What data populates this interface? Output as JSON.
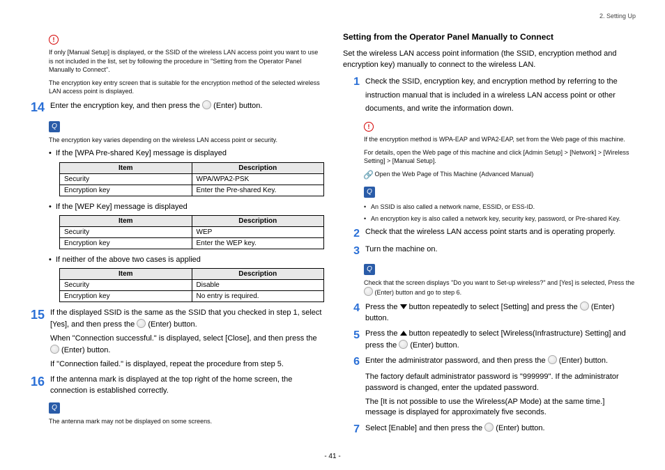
{
  "header": {
    "chapter": "2. Setting Up"
  },
  "page_number": "- 41 -",
  "left": {
    "warn1": {
      "lines": [
        "If only [Manual Setup] is displayed, or the SSID of the wireless LAN access point you want to use is not included in the list, set by following the procedure in \"Setting from the Operator Panel Manually to Connect\".",
        "The encryption key entry screen that is suitable for the encryption method of the selected wireless LAN access point is displayed."
      ]
    },
    "step14": {
      "num": "14",
      "text_a": "Enter the encryption key, and then press the ",
      "text_b": " (Enter) button."
    },
    "note14": "The encryption key varies depending on the wireless LAN access point or security.",
    "bullet_wpa": "If the [WPA Pre-shared Key] message is displayed",
    "bullet_wep": "If the [WEP Key] message is displayed",
    "bullet_none": "If neither of the above two cases is applied",
    "table_headers": {
      "item": "Item",
      "desc": "Description"
    },
    "table_wpa": [
      {
        "item": "Security",
        "desc": "WPA/WPA2-PSK"
      },
      {
        "item": "Encryption key",
        "desc": "Enter the Pre-shared Key."
      }
    ],
    "table_wep": [
      {
        "item": "Security",
        "desc": "WEP"
      },
      {
        "item": "Encryption key",
        "desc": "Enter the WEP key."
      }
    ],
    "table_none": [
      {
        "item": "Security",
        "desc": "Disable"
      },
      {
        "item": "Encryption key",
        "desc": "No entry is required."
      }
    ],
    "step15": {
      "num": "15",
      "line1a": "If the displayed SSID is the same as the SSID that you checked in step 1, select [Yes], and then press the ",
      "line1b": " (Enter) button.",
      "line2a": "When \"Connection successful.\" is displayed, select [Close], and then press the ",
      "line2b": " (Enter) button.",
      "line3": "If \"Connection failed.\" is displayed, repeat the procedure from step 5."
    },
    "step16": {
      "num": "16",
      "text": "If the antenna mark is displayed at the top right of the home screen, the connection is established correctly."
    },
    "note16": "The antenna mark may not be displayed on some screens."
  },
  "right": {
    "heading": "Setting from the Operator Panel Manually to Connect",
    "intro": "Set the wireless LAN access point information (the SSID, encryption method and encryption key) manually to connect to the wireless LAN.",
    "step1": {
      "num": "1",
      "text": "Check the SSID, encryption key, and encryption method by referring to the instruction manual that is included in a wireless LAN access point or other documents, and write the information down."
    },
    "warn1": {
      "lines": [
        "If the encryption method is WPA-EAP and WPA2-EAP, set from the Web page of this machine.",
        "For details, open the Web page of this machine and click [Admin Setup] > [Network] > [Wireless Setting] > [Manual Setup]."
      ]
    },
    "link1": "Open the Web Page of This Machine (Advanced Manual)",
    "note1": {
      "b1": "An SSID is also called a network name, ESSID, or ESS-ID.",
      "b2": "An encryption key is also called a network key, security key, password, or Pre-shared Key."
    },
    "step2": {
      "num": "2",
      "text": "Check that the wireless LAN access point starts and is operating properly."
    },
    "step3": {
      "num": "3",
      "text": "Turn the machine on."
    },
    "note3a": "Check that the screen displays \"Do you want to Set-up wireless?\" and [Yes] is selected, Press the ",
    "note3b": " (Enter) button and go to step 6.",
    "step4": {
      "num": "4",
      "a": "Press the ",
      "b": " button repeatedly to select [Setting] and press the ",
      "c": " (Enter) button."
    },
    "step5": {
      "num": "5",
      "a": "Press the ",
      "b": " button repeatedly to select [Wireless(Infrastructure) Setting] and press the ",
      "c": " (Enter) button."
    },
    "step6": {
      "num": "6",
      "a": "Enter the administrator password, and then press the ",
      "b": " (Enter) button.",
      "sub1": "The factory default administrator password is \"999999\". If the administrator password is changed, enter the updated password.",
      "sub2": "The [It is not possible to use the Wireless(AP Mode) at the same time.] message is displayed for approximately five seconds."
    },
    "step7": {
      "num": "7",
      "a": "Select [Enable] and then press the ",
      "b": " (Enter) button."
    }
  }
}
